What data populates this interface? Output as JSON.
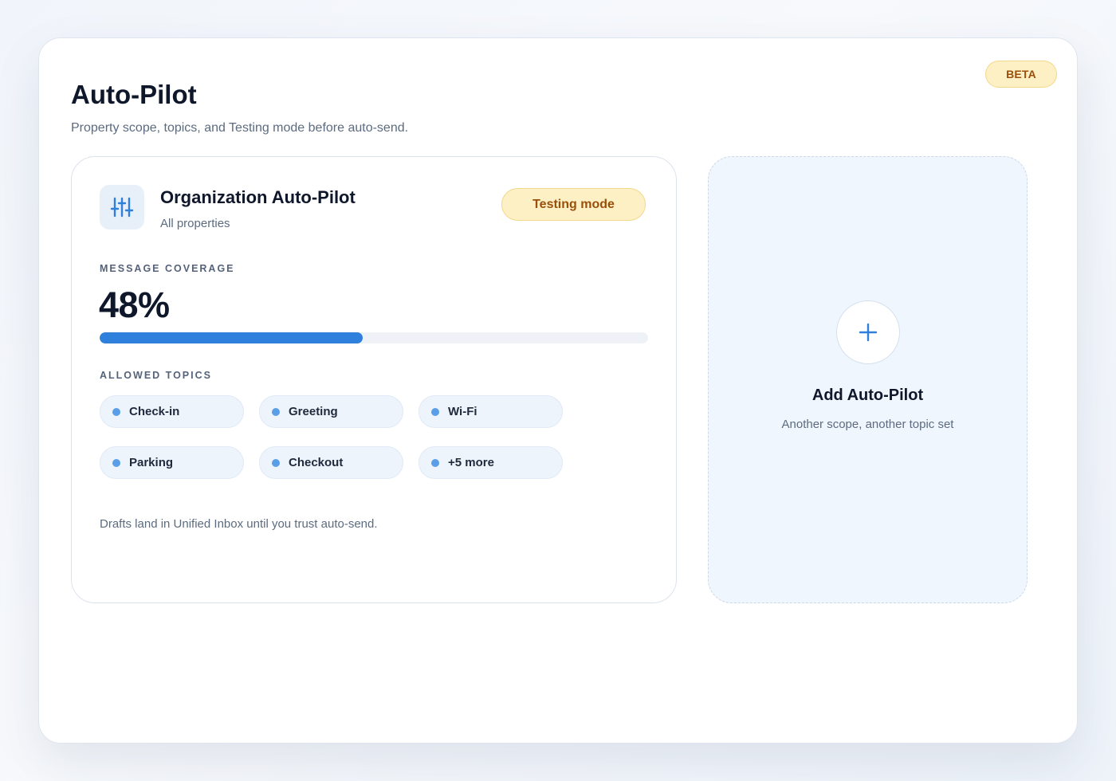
{
  "header": {
    "beta_label": "BETA",
    "title": "Auto-Pilot",
    "subtitle": "Property scope, topics, and Testing mode before auto-send."
  },
  "autopilot_card": {
    "icon": "sliders-icon",
    "title": "Organization Auto-Pilot",
    "scope": "All properties",
    "mode_badge": "Testing mode",
    "coverage_label": "MESSAGE COVERAGE",
    "coverage_value": "48%",
    "coverage_fraction": 0.48,
    "topics_label": "ALLOWED TOPICS",
    "topics": [
      "Check-in",
      "Greeting",
      "Wi-Fi",
      "Parking",
      "Checkout",
      "+5 more"
    ],
    "footer": "Drafts land in Unified Inbox until you trust auto-send."
  },
  "add_card": {
    "icon": "plus-icon",
    "title": "Add Auto-Pilot",
    "subtitle": "Another scope, another topic set"
  },
  "colors": {
    "accent": "#2f7fdc",
    "badge_bg": "#fdf0c4",
    "badge_text": "#9a4f0a",
    "topic_dot": "#5b9ee8"
  }
}
